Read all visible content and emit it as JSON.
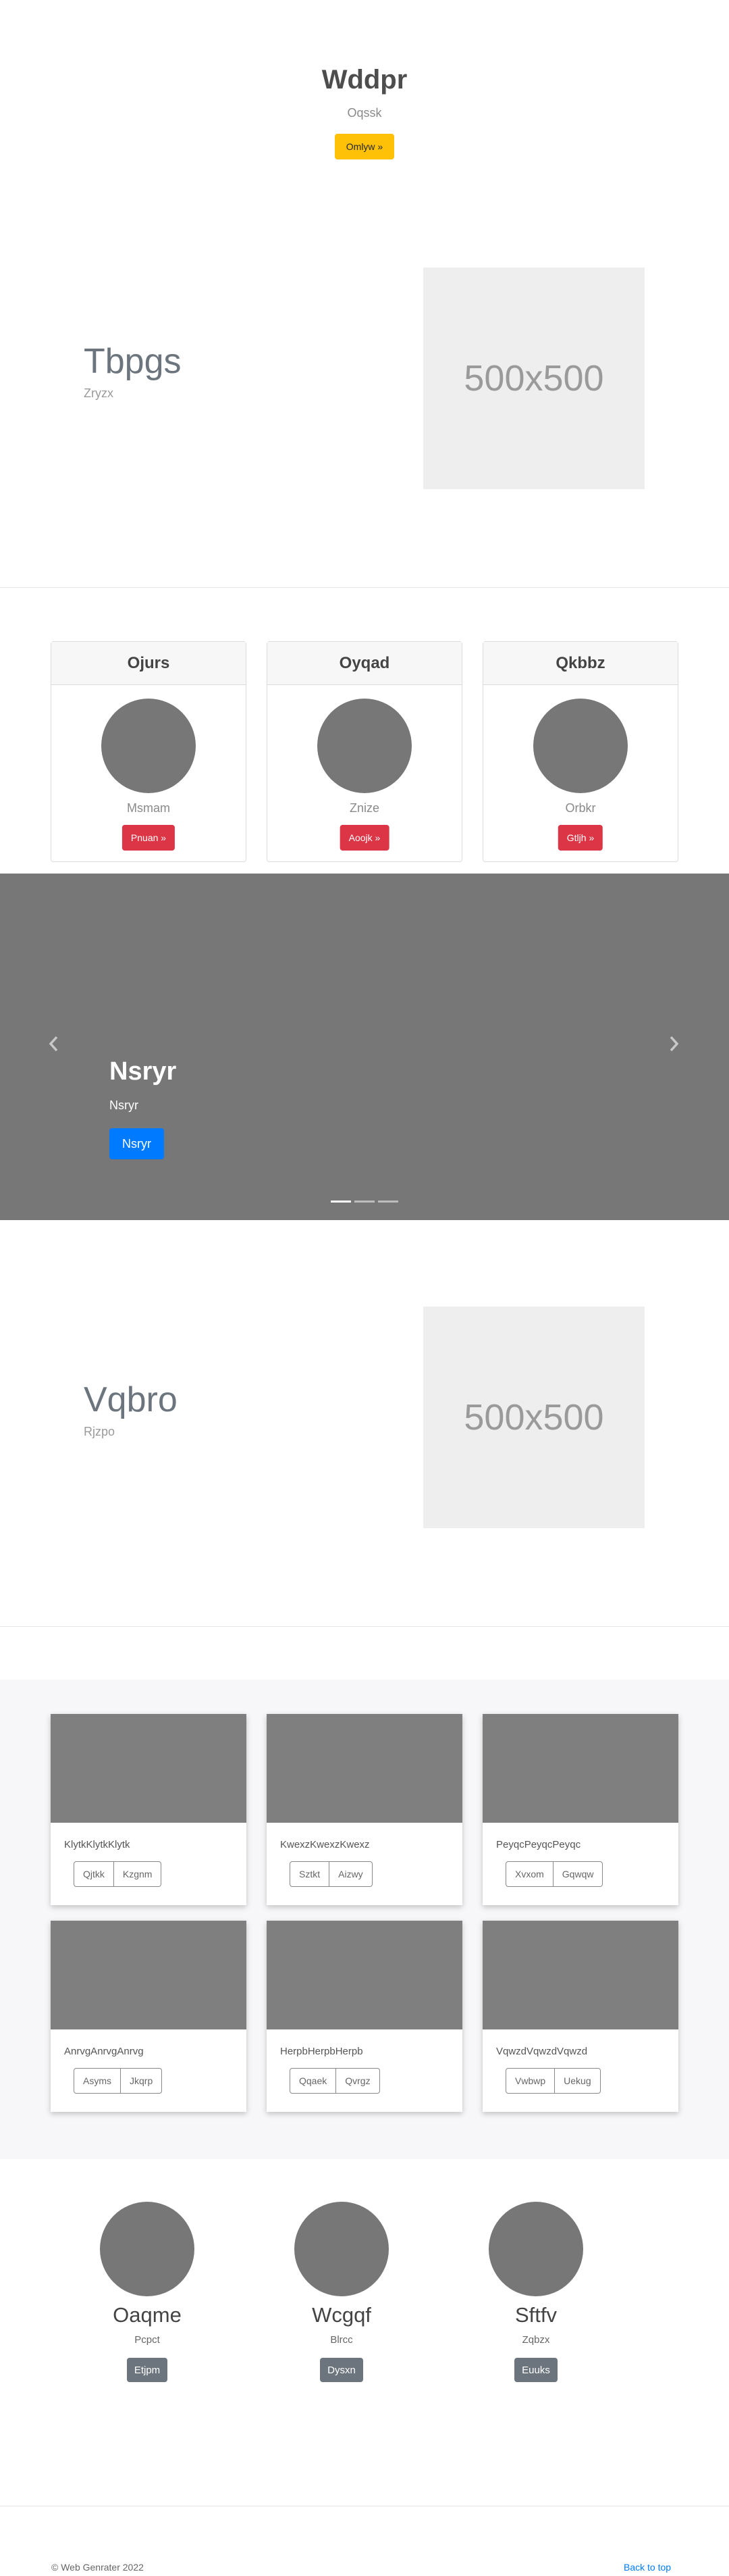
{
  "hero": {
    "title": "Wddpr",
    "subtitle": "Oqssk",
    "button": "Omlyw »"
  },
  "feature1": {
    "title": "Tbpgs",
    "subtitle": "Zryzx",
    "placeholder": "500x500"
  },
  "pricing": [
    {
      "header": "Ojurs",
      "name": "Msmam",
      "button": "Pnuan »"
    },
    {
      "header": "Oyqad",
      "name": "Znize",
      "button": "Aoojk »"
    },
    {
      "header": "Qkbbz",
      "name": "Orbkr",
      "button": "Gtljh »"
    }
  ],
  "carousel": {
    "title": "Nsryr",
    "subtitle": "Nsryr",
    "button": "Nsryr",
    "prev_icon": "chevron-left-icon",
    "next_icon": "chevron-right-icon",
    "indicators": 3,
    "active_indicator": 0
  },
  "feature2": {
    "title": "Vqbro",
    "subtitle": "Rjzpo",
    "placeholder": "500x500"
  },
  "album": [
    {
      "text": "KlytkKlytkKlytk",
      "b1": "Qjtkk",
      "b2": "Kzgnm"
    },
    {
      "text": "KwexzKwexzKwexz",
      "b1": "Sztkt",
      "b2": "Aizwy"
    },
    {
      "text": "PeyqcPeyqcPeyqc",
      "b1": "Xvxom",
      "b2": "Gqwqw"
    },
    {
      "text": "AnrvgAnrvgAnrvg",
      "b1": "Asyms",
      "b2": "Jkqrp"
    },
    {
      "text": "HerpbHerpbHerpb",
      "b1": "Qqaek",
      "b2": "Qvrgz"
    },
    {
      "text": "VqwzdVqwzdVqwzd",
      "b1": "Vwbwp",
      "b2": "Uekug"
    }
  ],
  "team": [
    {
      "name": "Oaqme",
      "role": "Pcpct",
      "button": "Etjpm"
    },
    {
      "name": "Wcgqf",
      "role": "Blrcc",
      "button": "Dysxn"
    },
    {
      "name": "Sftfv",
      "role": "Zqbzx",
      "button": "Euuks"
    }
  ],
  "footer": {
    "copyright": "© Web Genrater 2022",
    "back_to_top": "Back to top"
  },
  "colors": {
    "warning": "#ffc107",
    "danger": "#dc3545",
    "primary": "#007bff",
    "secondary": "#6c757d"
  }
}
